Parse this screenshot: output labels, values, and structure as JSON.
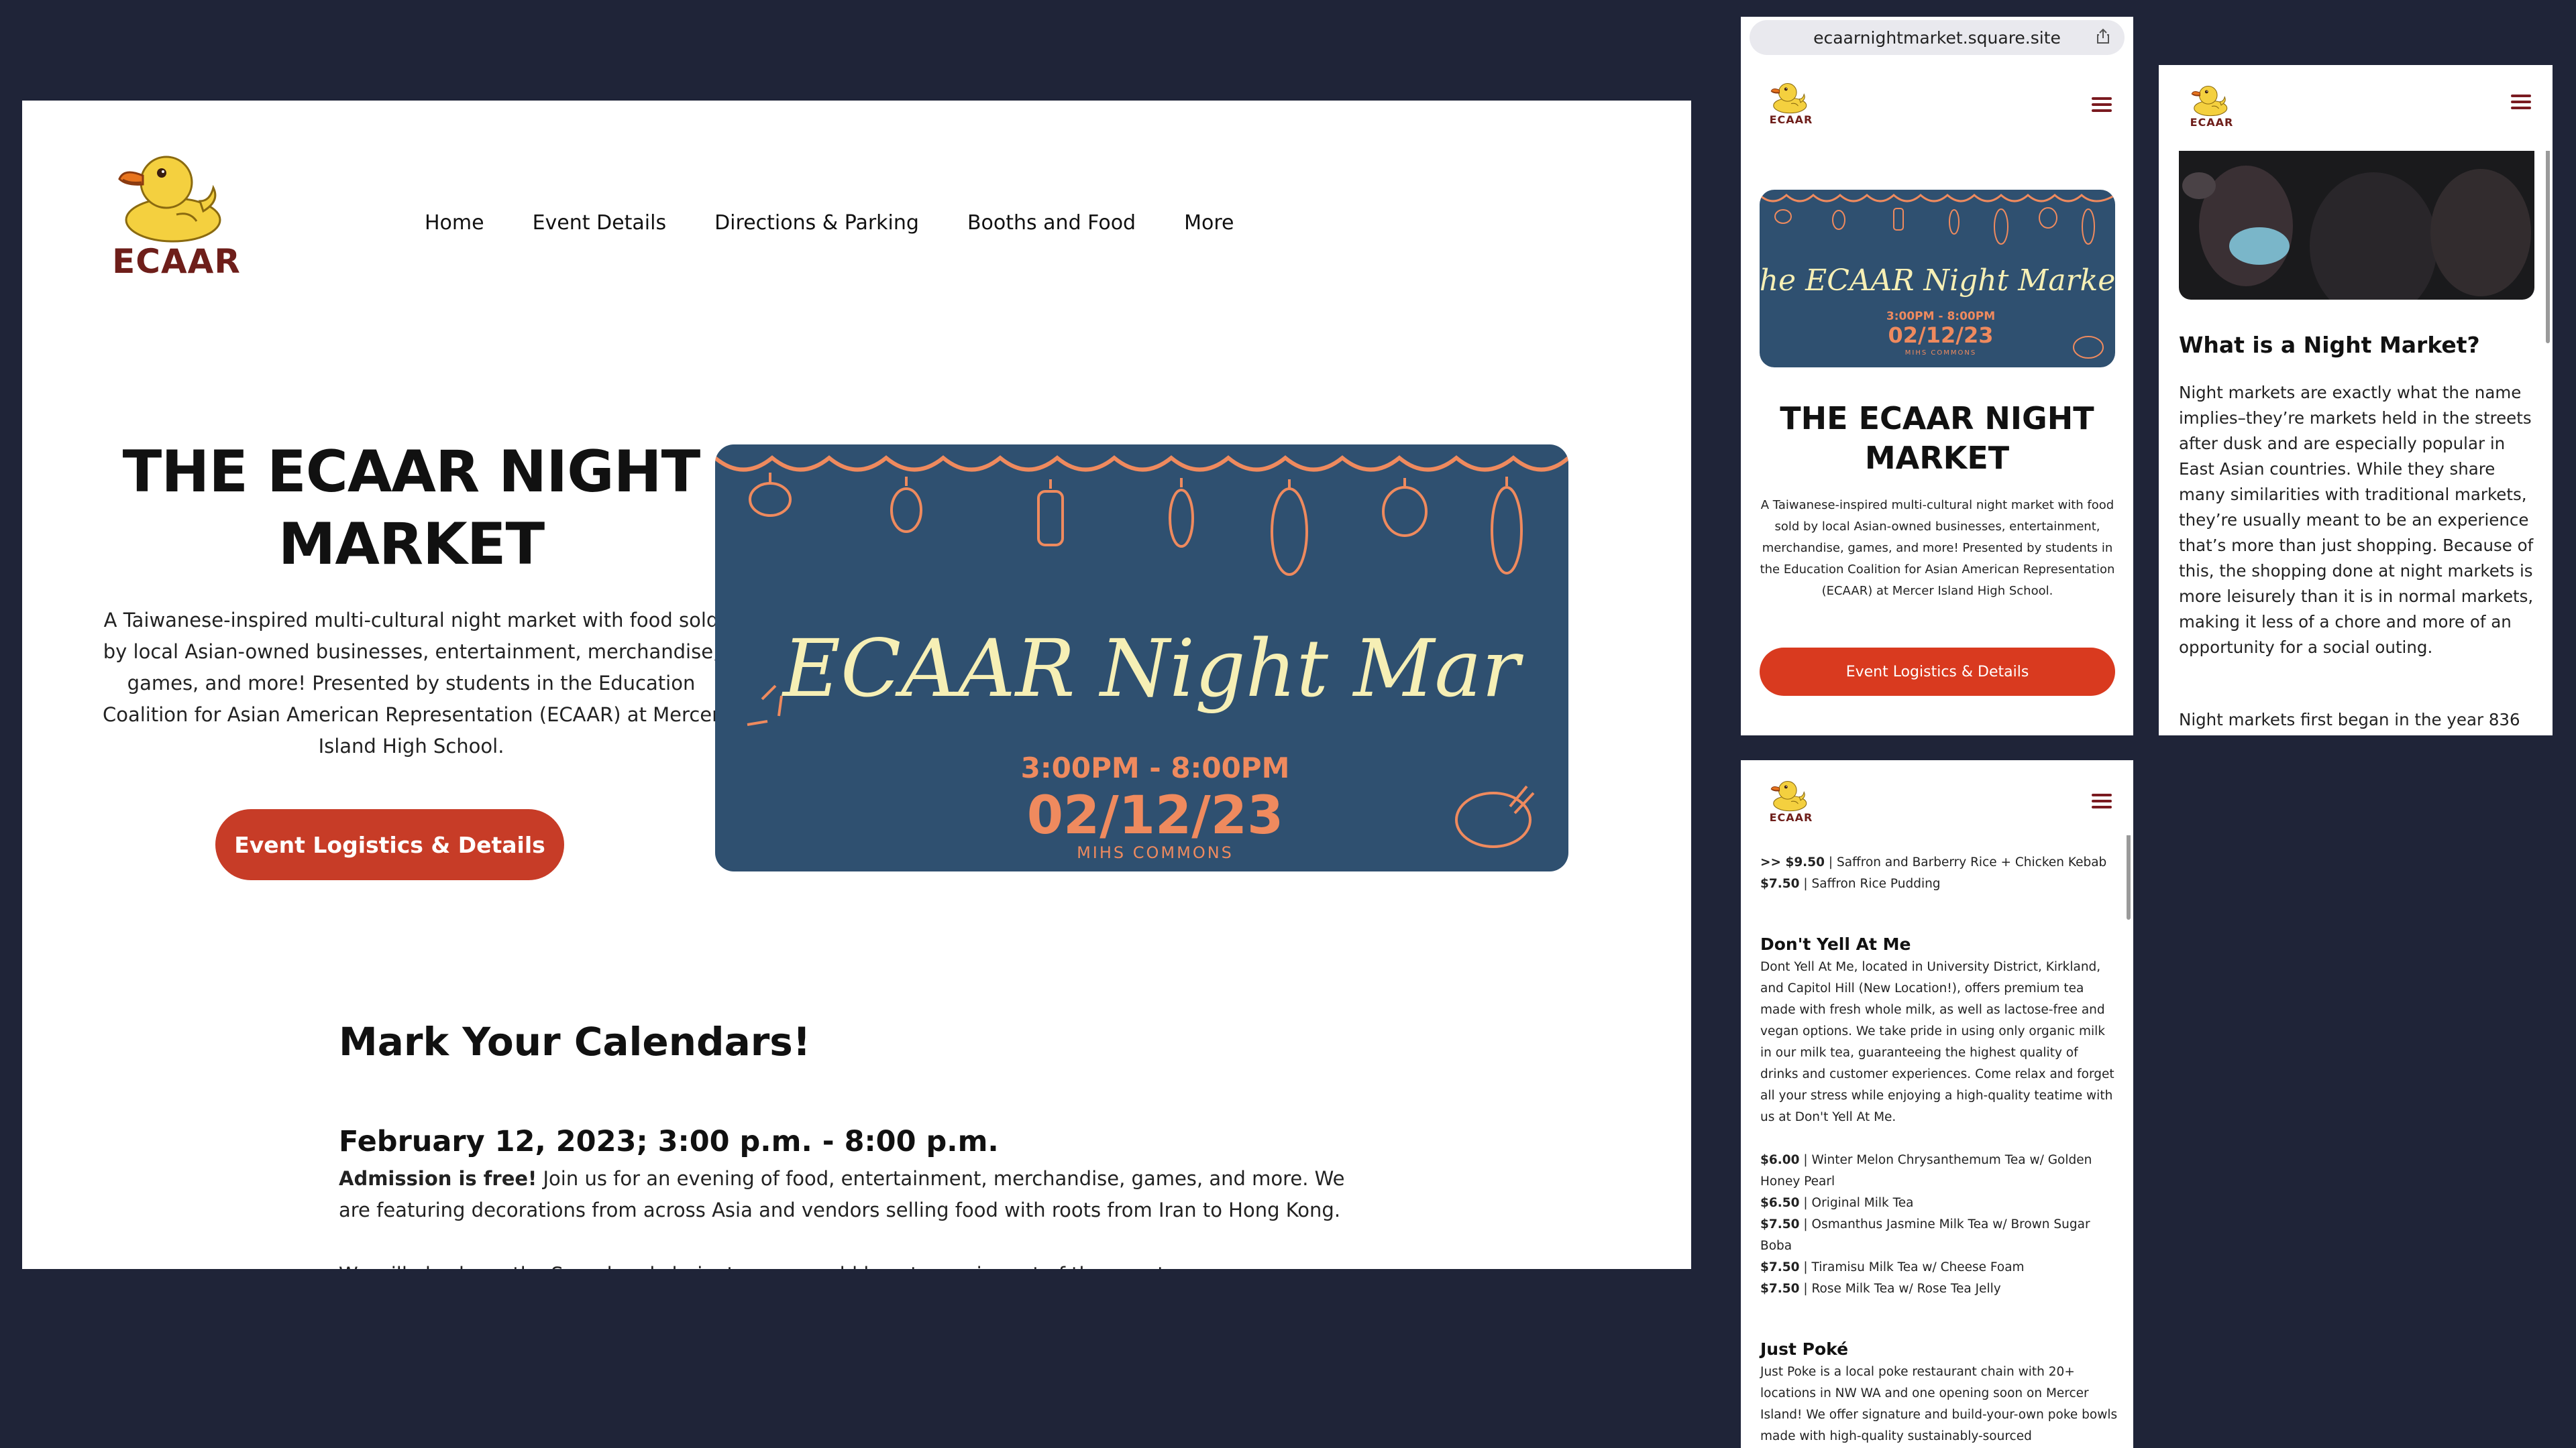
{
  "brand": {
    "logo_text": "ECAAR"
  },
  "nav": [
    {
      "label": "Home"
    },
    {
      "label": "Event Details"
    },
    {
      "label": "Directions & Parking"
    },
    {
      "label": "Booths and Food"
    },
    {
      "label": "More"
    }
  ],
  "hero": {
    "title": "THE ECAAR NIGHT MARKET",
    "description": "A Taiwanese-inspired multi-cultural night market with food sold by local Asian-owned businesses, entertainment, merchandise, games, and more! Presented by students in the Education Coalition for Asian American Representation (ECAAR) at Mercer Island High School.",
    "cta_label": "Event Logistics & Details"
  },
  "banner": {
    "headline_desktop": "ECAAR Night Mar",
    "headline_mobile": "the ECAAR Night Market",
    "time": "3:00PM - 8:00PM",
    "date": "02/12/23",
    "venue": "MIHS COMMONS"
  },
  "calendar": {
    "heading": "Mark Your Calendars!",
    "date_line": "February 12, 2023; 3:00 p.m. - 8:00 p.m.",
    "admission_bold": "Admission is free!",
    "admission_text": " Join us for an evening of food, entertainment, merchandise, games, and more. We are featuring decorations from across Asia and vendors selling food with roots from Iran to Hong Kong.",
    "cut_line": "We will also have the Sound and clarinet ... we would love to see in part of the event."
  },
  "mobile": {
    "url": "ecaarnightmarket.square.site",
    "cta_label": "Event Logistics & Details"
  },
  "night_market_info": {
    "heading": "What is a Night Market?",
    "paragraph": "Night markets are exactly what the name implies–they’re markets held in the streets after dusk and are especially popular in East Asian countries. While they share many similarities with traditional markets, they’re usually meant to be an experience that’s more than just shopping. Because of this, the shopping done at night markets is more leisurely than it is in normal markets, making it less of a chore and more of an opportunity for a social outing.",
    "paragraph2": "Night markets first began in the year 836"
  },
  "vendors": {
    "items_top": [
      {
        "price": ">> $9.50",
        "name": " | Saffron and Barberry Rice + Chicken Kebab"
      },
      {
        "price": "$7.50",
        "name": " | Saffron Rice Pudding"
      }
    ],
    "dyam": {
      "name": "Don't Yell At Me",
      "description": "Dont Yell At Me, located in University District, Kirkland, and Capitol Hill (New Location!), offers premium tea made with fresh whole milk, as well as lactose-free and vegan options. We take pride in using only organic milk in our milk tea, guaranteeing the highest quality of drinks and customer experiences. Come relax and forget all your stress while enjoying a high-quality teatime with us at Don't Yell At Me.",
      "menu": [
        {
          "price": "$6.00",
          "name": " | Winter Melon Chrysanthemum Tea w/ Golden Honey Pearl"
        },
        {
          "price": "$6.50",
          "name": " | Original Milk Tea"
        },
        {
          "price": "$7.50",
          "name": " | Osmanthus Jasmine Milk Tea w/ Brown Sugar Boba"
        },
        {
          "price": "$7.50",
          "name": " | Tiramisu Milk Tea w/ Cheese Foam"
        },
        {
          "price": "$7.50",
          "name": " | Rose Milk Tea w/ Rose Tea Jelly"
        }
      ]
    },
    "poke": {
      "name": "Just Poké",
      "description": "Just Poke is a local poke restaurant chain with 20+ locations in NW WA and one opening soon on Mercer Island! We offer signature and build-your-own poke bowls made with high-quality sustainably-sourced"
    }
  },
  "colors": {
    "background": "#1f2438",
    "cta": "#c73c27",
    "banner_bg": "#2f5070",
    "banner_orange": "#ef8a5e",
    "banner_cream": "#f6efb5",
    "logo_text": "#6e1e1a"
  }
}
